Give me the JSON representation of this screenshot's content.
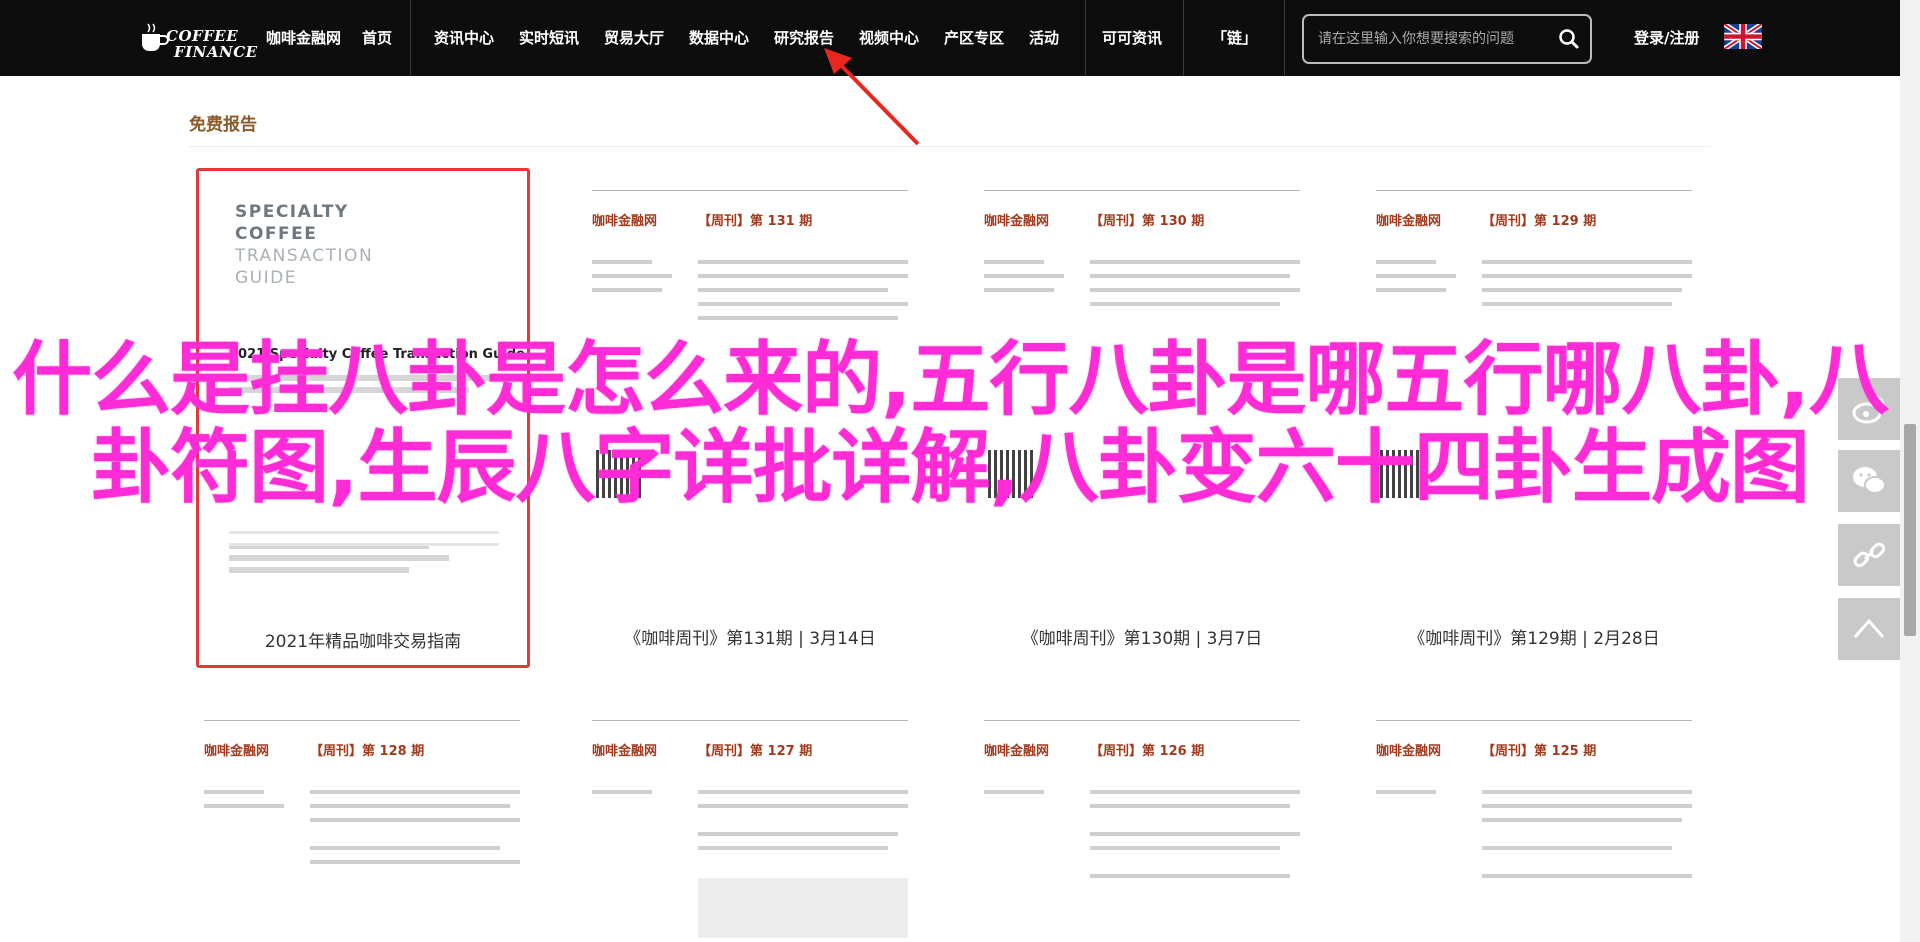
{
  "topbar": {
    "logo": {
      "line1": "COFFEE",
      "line2": "FINANCE"
    },
    "nav": [
      {
        "label": "咖啡金融网"
      },
      {
        "label": "首页"
      },
      {
        "label": "资讯中心"
      },
      {
        "label": "实时短讯"
      },
      {
        "label": "贸易大厅"
      },
      {
        "label": "数据中心"
      },
      {
        "label": "研究报告"
      },
      {
        "label": "视频中心"
      },
      {
        "label": "产区专区"
      },
      {
        "label": "活动"
      },
      {
        "label": "可可资讯"
      },
      {
        "label": "「链」"
      }
    ],
    "search": {
      "placeholder": "请在这里输入你想要搜索的问题"
    },
    "login": "登录/注册"
  },
  "section": {
    "title": "免费报告"
  },
  "cards": [
    {
      "caption": "2021年精品咖啡交易指南",
      "cover": {
        "l1": "SPECIALTY",
        "l2": "COFFEE",
        "l3": "TRANSACTION",
        "l4": "GUIDE",
        "guide": "2021 Specialty Coffee Transaction Guide"
      }
    },
    {
      "caption": "《咖啡周刊》第131期 | 3月14日",
      "brand": "咖啡金融网",
      "issue": "【周刊】第 131 期"
    },
    {
      "caption": "《咖啡周刊》第130期 | 3月7日",
      "brand": "咖啡金融网",
      "issue": "【周刊】第 130 期"
    },
    {
      "caption": "《咖啡周刊》第129期 | 2月28日",
      "brand": "咖啡金融网",
      "issue": "【周刊】第 129 期"
    },
    {
      "brand": "咖啡金融网",
      "issue": "【周刊】第 128 期"
    },
    {
      "brand": "咖啡金融网",
      "issue": "【周刊】第 127 期"
    },
    {
      "brand": "咖啡金融网",
      "issue": "【周刊】第 126 期"
    },
    {
      "brand": "咖啡金融网",
      "issue": "【周刊】第 125 期"
    }
  ],
  "overlay": {
    "headline": "什么是挂八卦是怎么来的,五行八卦是哪五行哪八卦,八卦符图,生辰八字详批详解,八卦变六十四卦生成图"
  },
  "colors": {
    "topbar": "#0d0d0d",
    "accent_brown": "#8a5a2b",
    "highlight_red": "#e23a3a",
    "headline_magenta": "#ff2bd6",
    "social_gray": "#c9c9c9"
  },
  "icons": {
    "search": "search-icon",
    "flag": "uk-flag-icon",
    "social": [
      "weibo-icon",
      "wechat-icon",
      "share-link-icon",
      "back-to-top-icon"
    ]
  }
}
